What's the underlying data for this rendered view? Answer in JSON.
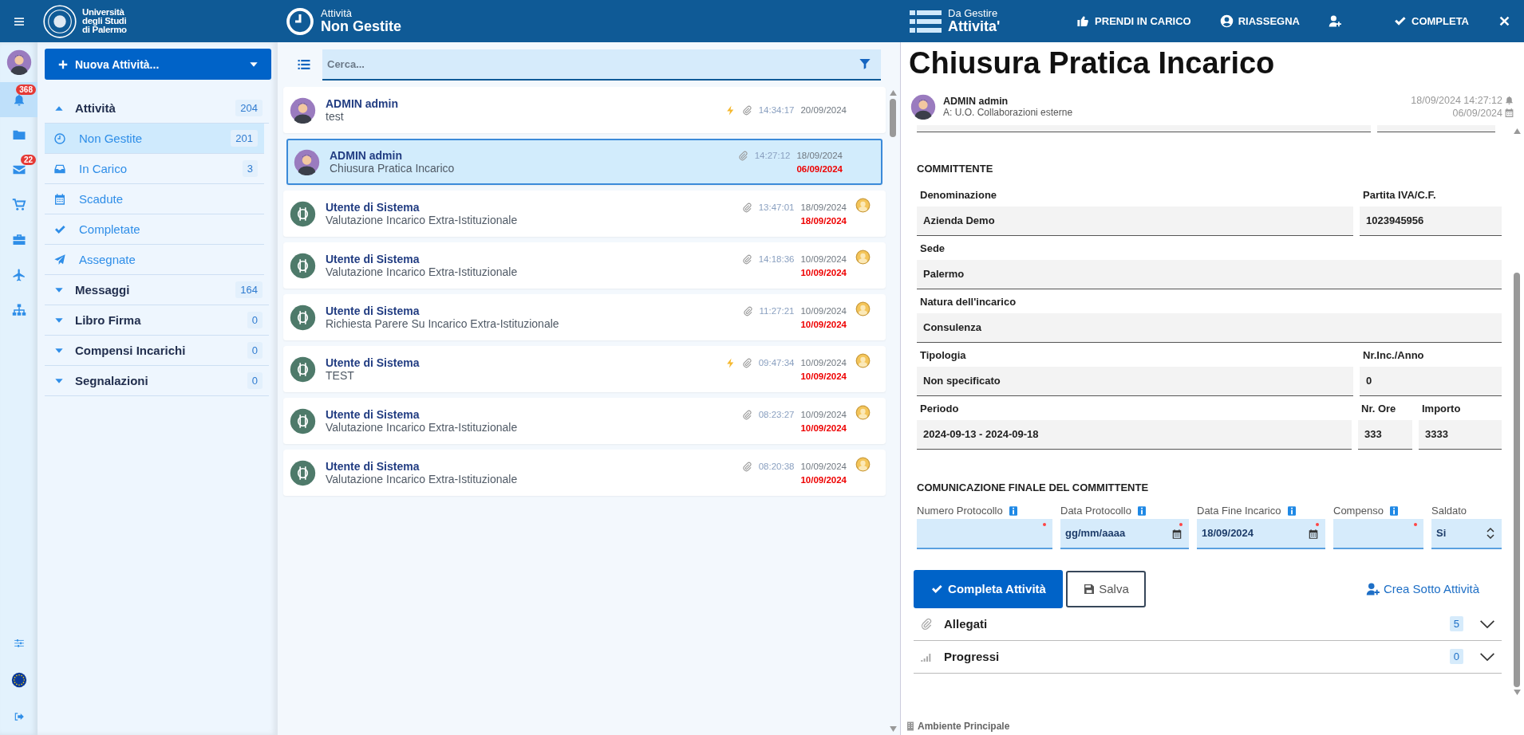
{
  "topbar": {
    "logo_lines": [
      "Università",
      "degli Studi",
      "di Palermo"
    ],
    "list_header": {
      "caption": "Attività",
      "title": "Non Gestite"
    },
    "detail_header": {
      "caption": "Da Gestire",
      "title": "Attivita'"
    },
    "actions": [
      {
        "kind": "text",
        "label": "PRENDI IN CARICO"
      },
      {
        "kind": "text",
        "label": "RIASSEGNA"
      },
      {
        "kind": "icon"
      },
      {
        "kind": "text",
        "label": "COMPLETA"
      },
      {
        "kind": "icon"
      }
    ]
  },
  "rail": [
    {
      "selected": false
    },
    {
      "badge": "368",
      "selected": true
    },
    {
      "selected": false
    },
    {
      "badge": "22",
      "selected": false
    },
    {
      "selected": false
    },
    {
      "selected": false
    },
    {
      "selected": false
    },
    {
      "selected": false
    }
  ],
  "sidebar": {
    "new_button": "Nuova Attività...",
    "groups": [
      {
        "label": "Attività",
        "count": "204",
        "expanded": true,
        "children": [
          {
            "label": "Non Gestite",
            "count": "201",
            "selected": true
          },
          {
            "label": "In Carico",
            "count": "3",
            "selected": false
          },
          {
            "label": "Scadute",
            "selected": false
          },
          {
            "label": "Completate",
            "selected": false
          },
          {
            "label": "Assegnate",
            "selected": false
          }
        ]
      },
      {
        "label": "Messaggi",
        "count": "164",
        "expanded": false
      },
      {
        "label": "Libro Firma",
        "count": "0",
        "expanded": false
      },
      {
        "label": "Compensi Incarichi",
        "count": "0",
        "expanded": false
      },
      {
        "label": "Segnalazioni",
        "count": "0",
        "expanded": false
      }
    ]
  },
  "search": {
    "placeholder": "Cerca..."
  },
  "items": [
    {
      "kind": "person",
      "author": "ADMIN admin",
      "subject": "test",
      "urgent": true,
      "attachment": true,
      "time": "14:34:17",
      "date": "20/09/2024",
      "assigned": false,
      "selected": false
    },
    {
      "kind": "person",
      "author": "ADMIN admin",
      "subject": "Chiusura Pratica Incarico",
      "urgent": false,
      "attachment": true,
      "time": "14:27:12",
      "date": "18/09/2024",
      "due": "06/09/2024",
      "assigned": false,
      "selected": true
    },
    {
      "kind": "system",
      "author": "Utente di Sistema",
      "subject": "Valutazione Incarico Extra-Istituzionale",
      "urgent": false,
      "attachment": true,
      "time": "13:47:01",
      "date": "18/09/2024",
      "due": "18/09/2024",
      "assigned": true,
      "selected": false
    },
    {
      "kind": "system",
      "author": "Utente di Sistema",
      "subject": "Valutazione Incarico Extra-Istituzionale",
      "urgent": false,
      "attachment": true,
      "time": "14:18:36",
      "date": "10/09/2024",
      "due": "10/09/2024",
      "assigned": true,
      "selected": false
    },
    {
      "kind": "system",
      "author": "Utente di Sistema",
      "subject": "Richiesta Parere Su Incarico Extra-Istituzionale",
      "urgent": false,
      "attachment": true,
      "time": "11:27:21",
      "date": "10/09/2024",
      "due": "10/09/2024",
      "assigned": true,
      "selected": false
    },
    {
      "kind": "system",
      "author": "Utente di Sistema",
      "subject": "TEST",
      "urgent": true,
      "attachment": true,
      "time": "09:47:34",
      "date": "10/09/2024",
      "due": "10/09/2024",
      "assigned": true,
      "selected": false
    },
    {
      "kind": "system",
      "author": "Utente di Sistema",
      "subject": "Valutazione Incarico Extra-Istituzionale",
      "urgent": false,
      "attachment": true,
      "time": "08:23:27",
      "date": "10/09/2024",
      "due": "10/09/2024",
      "assigned": true,
      "selected": false
    },
    {
      "kind": "system",
      "author": "Utente di Sistema",
      "subject": "Valutazione Incarico Extra-Istituzionale",
      "urgent": false,
      "attachment": true,
      "time": "08:20:38",
      "date": "10/09/2024",
      "due": "10/09/2024",
      "assigned": true,
      "selected": false
    }
  ],
  "detail": {
    "title": "Chiusura Pratica Incarico",
    "author": "ADMIN admin",
    "recipient": "A: U.O. Collaborazioni esterne",
    "created": "18/09/2024 14:27:12",
    "due": "06/09/2024",
    "section_title": "COMMITTENTE",
    "rows": [
      [
        {
          "label": "Denominazione",
          "value": "Azienda Demo"
        },
        {
          "label": "Partita IVA/C.F.",
          "value": "1023945956"
        }
      ],
      [
        {
          "label": "Sede",
          "value": "Palermo"
        }
      ],
      [
        {
          "label": "Natura dell'incarico",
          "value": "Consulenza"
        }
      ],
      [
        {
          "label": "Tipologia",
          "value": "Non specificato"
        },
        {
          "label": "Nr.Inc./Anno",
          "value": "0"
        }
      ],
      [
        {
          "label": "Periodo",
          "value": "2024-09-13 - 2024-09-18"
        },
        {
          "label": "Nr. Ore",
          "value": "333"
        },
        {
          "label": "Importo",
          "value": "3333"
        }
      ]
    ],
    "form_title": "COMUNICAZIONE FINALE DEL COMMITTENTE",
    "inputs": [
      {
        "kind": "text",
        "label": "Numero Protocollo",
        "info": true,
        "required": true
      },
      {
        "kind": "date",
        "label": "Data Protocollo",
        "info": true,
        "required": true,
        "placeholder": "gg/mm/aaaa"
      },
      {
        "kind": "date",
        "label": "Data Fine Incarico",
        "info": true,
        "required": true,
        "value": "18/09/2024"
      },
      {
        "kind": "text",
        "label": "Compenso",
        "info": true,
        "required": true
      },
      {
        "kind": "select",
        "label": "Saldato",
        "info": false,
        "required": false,
        "value": "Si"
      }
    ],
    "primary_button": "Completa Attività",
    "save_button": "Salva",
    "sub_link": "Crea Sotto Attività",
    "panels": [
      {
        "label": "Allegati",
        "count": "5",
        "expanded": false
      },
      {
        "label": "Progressi",
        "count": "0",
        "expanded": false
      }
    ],
    "footer": "Ambiente Principale"
  }
}
